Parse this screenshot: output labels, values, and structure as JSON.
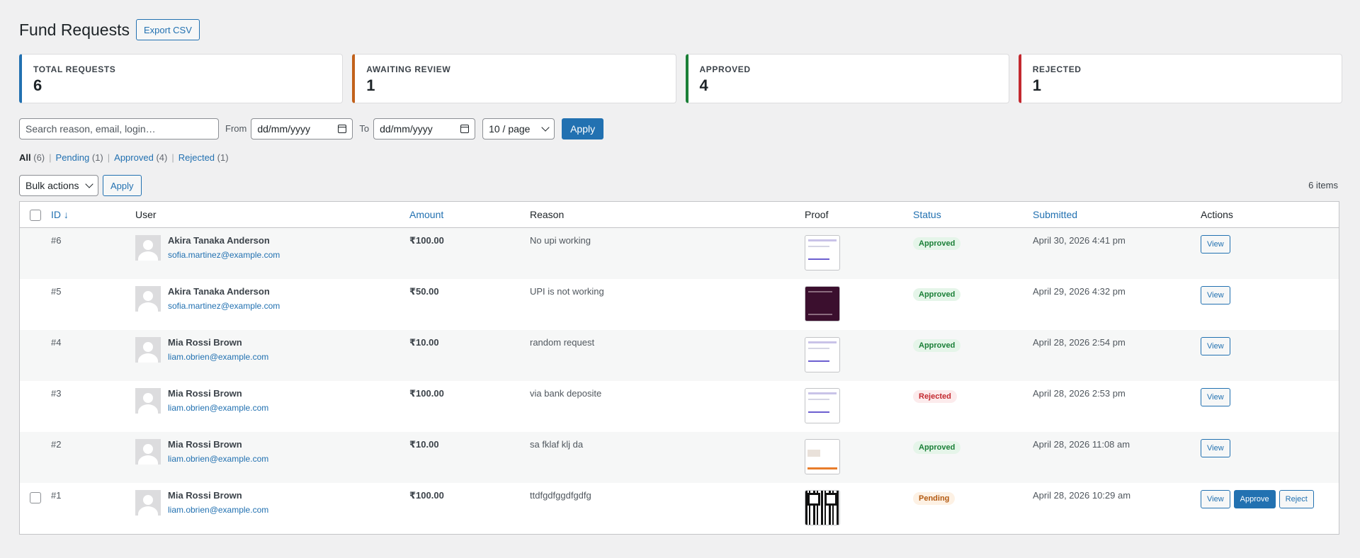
{
  "header": {
    "title": "Fund Requests",
    "export_label": "Export CSV"
  },
  "stats": [
    {
      "label": "TOTAL REQUESTS",
      "value": "6",
      "color": "#2271b1"
    },
    {
      "label": "AWAITING REVIEW",
      "value": "1",
      "color": "#c2611b"
    },
    {
      "label": "APPROVED",
      "value": "4",
      "color": "#1a7f37"
    },
    {
      "label": "REJECTED",
      "value": "1",
      "color": "#c3282f"
    }
  ],
  "filters": {
    "search_placeholder": "Search reason, email, login…",
    "from_label": "From",
    "from_value": "dd/mm/yyyy",
    "to_label": "To",
    "to_value": "dd/mm/yyyy",
    "per_page": "10 / page",
    "apply_label": "Apply"
  },
  "views": {
    "all": "All",
    "all_count": "(6)",
    "pending": "Pending",
    "pending_count": "(1)",
    "approved": "Approved",
    "approved_count": "(4)",
    "rejected": "Rejected",
    "rejected_count": "(1)"
  },
  "tablenav": {
    "bulk_label": "Bulk actions",
    "apply_label": "Apply",
    "items_count": "6 items"
  },
  "columns": {
    "id": "ID ↓",
    "user": "User",
    "amount": "Amount",
    "reason": "Reason",
    "proof": "Proof",
    "status": "Status",
    "submitted": "Submitted",
    "actions": "Actions"
  },
  "rows": [
    {
      "id": "#6",
      "name": "Akira Tanaka Anderson",
      "email": "sofia.martinez@example.com",
      "amount": "₹100.00",
      "reason": "No upi working",
      "status": "Approved",
      "submitted": "April 30, 2026 4:41 pm",
      "view": "View"
    },
    {
      "id": "#5",
      "name": "Akira Tanaka Anderson",
      "email": "sofia.martinez@example.com",
      "amount": "₹50.00",
      "reason": "UPI is not working",
      "status": "Approved",
      "submitted": "April 29, 2026 4:32 pm",
      "view": "View"
    },
    {
      "id": "#4",
      "name": "Mia Rossi Brown",
      "email": "liam.obrien@example.com",
      "amount": "₹10.00",
      "reason": "random request",
      "status": "Approved",
      "submitted": "April 28, 2026 2:54 pm",
      "view": "View"
    },
    {
      "id": "#3",
      "name": "Mia Rossi Brown",
      "email": "liam.obrien@example.com",
      "amount": "₹100.00",
      "reason": "via bank deposite",
      "status": "Rejected",
      "submitted": "April 28, 2026 2:53 pm",
      "view": "View"
    },
    {
      "id": "#2",
      "name": "Mia Rossi Brown",
      "email": "liam.obrien@example.com",
      "amount": "₹10.00",
      "reason": "sa fklaf klj da",
      "status": "Approved",
      "submitted": "April 28, 2026 11:08 am",
      "view": "View"
    },
    {
      "id": "#1",
      "name": "Mia Rossi Brown",
      "email": "liam.obrien@example.com",
      "amount": "₹100.00",
      "reason": "ttdfgdfggdfgdfg",
      "status": "Pending",
      "submitted": "April 28, 2026 10:29 am",
      "view": "View",
      "approve": "Approve",
      "reject": "Reject"
    }
  ]
}
